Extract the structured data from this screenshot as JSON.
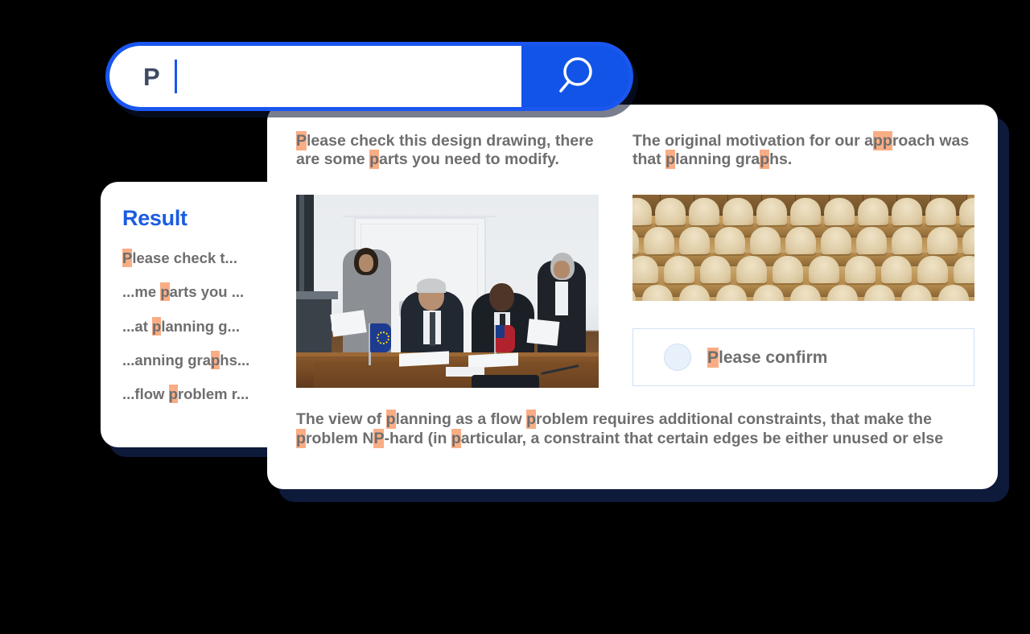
{
  "theme": {
    "background": "#000000",
    "accent_blue": "#1254e8",
    "card_shadow_navy": "#0e1a3a",
    "highlight_peach": "#f9ad84",
    "body_text_gray": "#6e6e6e",
    "result_title_blue": "#1b5ce0"
  },
  "search": {
    "value": "P",
    "icon": "search-icon",
    "button_label": ""
  },
  "result_panel": {
    "title": "Result",
    "items": [
      {
        "pre": "",
        "hl": "P",
        "post": "lease check t..."
      },
      {
        "pre": "...me ",
        "hl": "p",
        "post": "arts you ..."
      },
      {
        "pre": "...at ",
        "hl": "p",
        "post": "lanning g..."
      },
      {
        "pre": "...anning gra",
        "hl": "p",
        "post": "hs..."
      },
      {
        "pre": "...flow ",
        "hl": "p",
        "post": "roblem r..."
      }
    ]
  },
  "main": {
    "left_column": {
      "blurb": [
        {
          "t": "",
          "h": false
        },
        {
          "t": "P",
          "h": true
        },
        {
          "t": "lease check this design drawing, there are some ",
          "h": false
        },
        {
          "t": "p",
          "h": true
        },
        {
          "t": "arts you need to modify.",
          "h": false
        }
      ],
      "image_alt": "meeting-room-signing-photo"
    },
    "right_column": {
      "blurb": [
        {
          "t": "The original motivation for our a",
          "h": false
        },
        {
          "t": "pp",
          "h": true
        },
        {
          "t": "roach was that ",
          "h": false
        },
        {
          "t": "p",
          "h": true
        },
        {
          "t": "lanning gra",
          "h": false
        },
        {
          "t": "p",
          "h": true
        },
        {
          "t": "hs.",
          "h": false
        }
      ],
      "image_alt": "auditorium-wooden-seats-photo",
      "confirm": {
        "radio_state": "unchecked",
        "label": [
          {
            "t": "P",
            "h": true
          },
          {
            "t": "lease confirm",
            "h": false
          }
        ]
      }
    },
    "bottom_paragraph": [
      {
        "t": "The view of ",
        "h": false
      },
      {
        "t": "p",
        "h": true
      },
      {
        "t": "lanning as a flow ",
        "h": false
      },
      {
        "t": "p",
        "h": true
      },
      {
        "t": "roblem requires additional constraints, that make the ",
        "h": false
      },
      {
        "t": "p",
        "h": true
      },
      {
        "t": "roblem N",
        "h": false
      },
      {
        "t": "P",
        "h": true
      },
      {
        "t": "-hard (in ",
        "h": false
      },
      {
        "t": "p",
        "h": true
      },
      {
        "t": "articular, a constraint that certain edges be either unused or else",
        "h": false
      }
    ]
  }
}
